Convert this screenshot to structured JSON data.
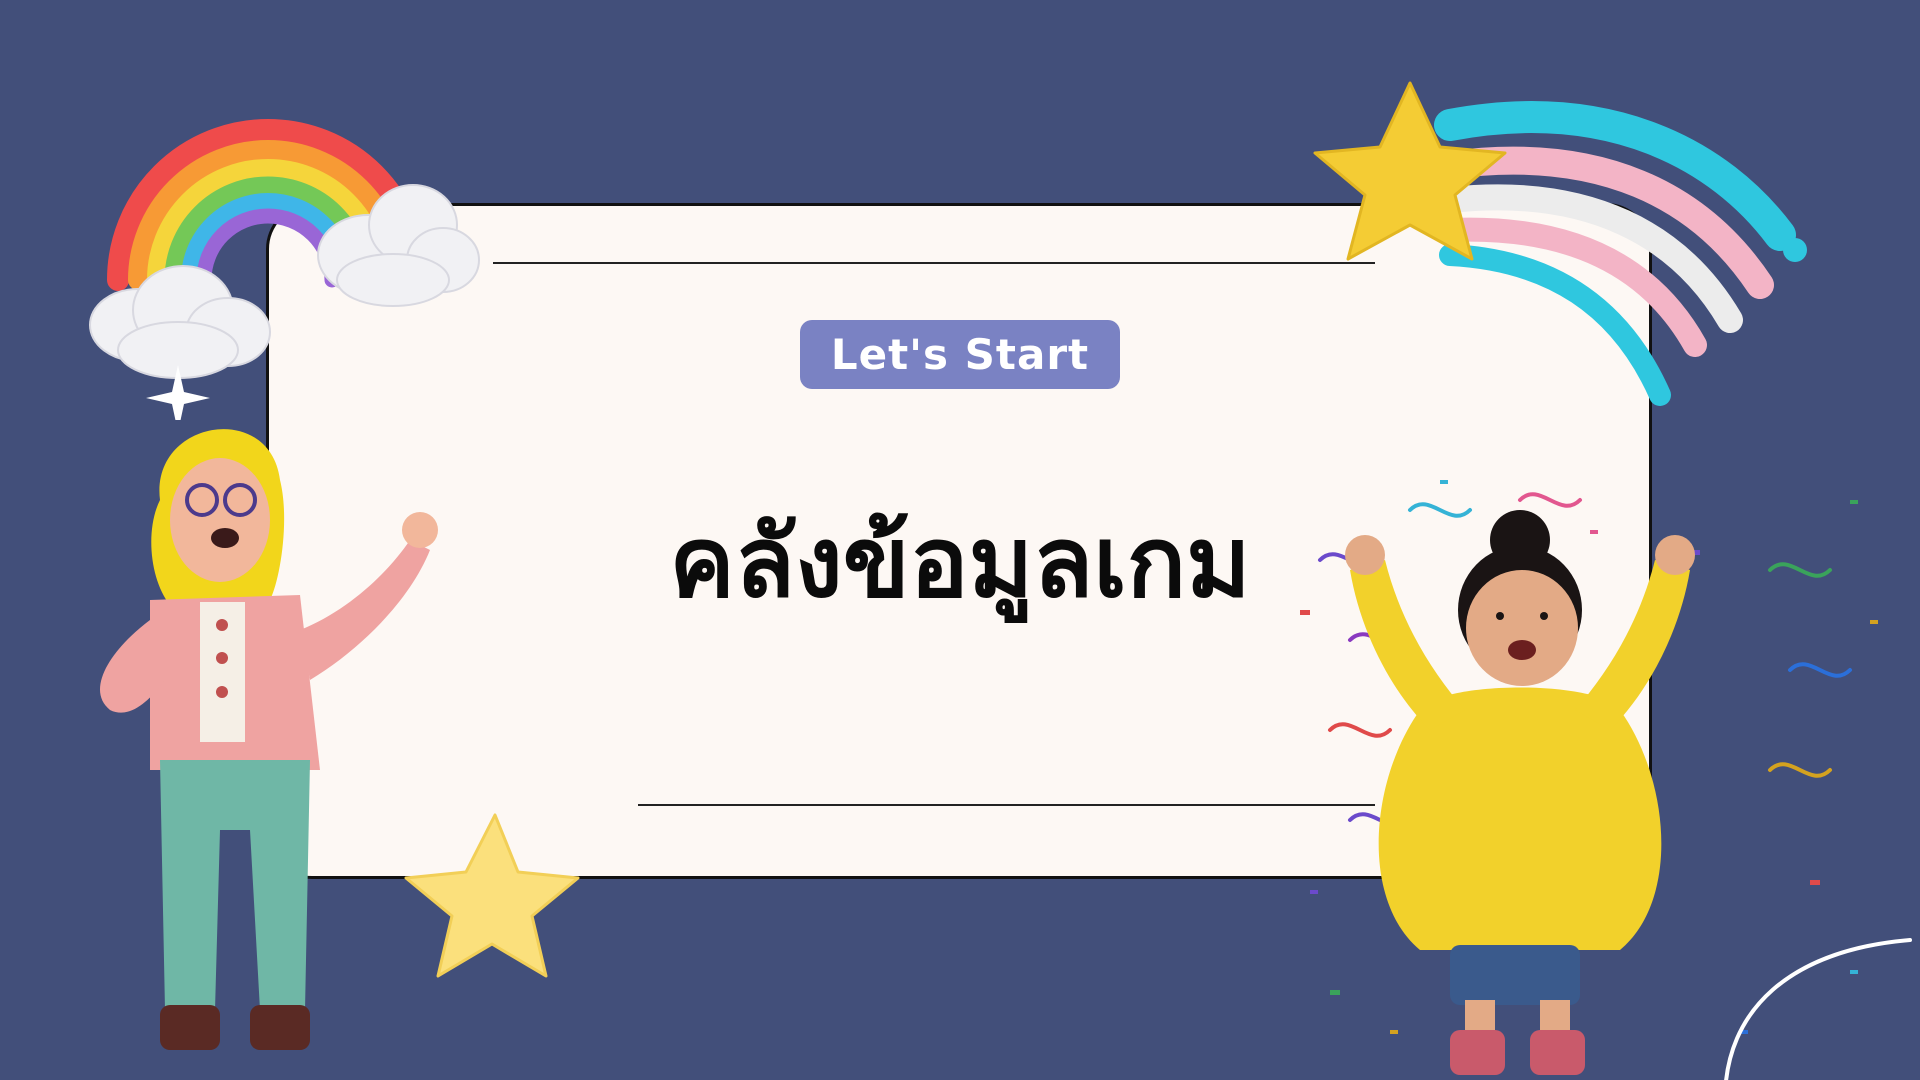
{
  "slide": {
    "badge_label": "Let's Start",
    "title": "คลังข้อมูลเกม"
  },
  "colors": {
    "background": "#424f7a",
    "card": "#fdf8f4",
    "badge": "#7a82c3",
    "title_text": "#0b0b0b"
  },
  "illustrations": [
    "rainbow-with-clouds",
    "sparkle",
    "shooting-star",
    "yellow-star",
    "waving-girl-left",
    "cheering-girl-right",
    "confetti",
    "white-arc"
  ]
}
